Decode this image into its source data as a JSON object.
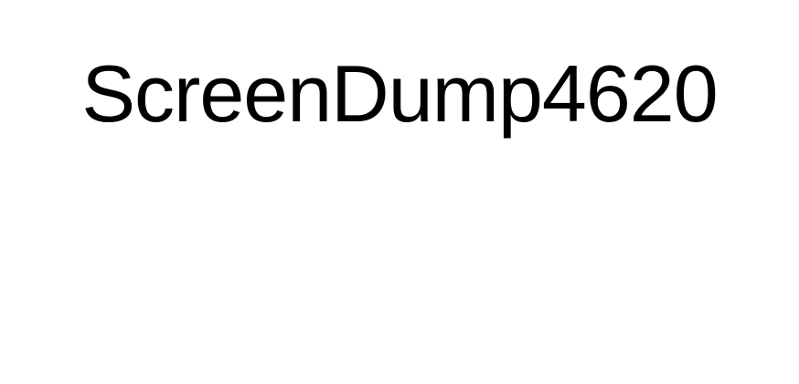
{
  "title": "ScreenDump4620",
  "colors": {
    "background": "#ffffff",
    "text": "#000000"
  }
}
